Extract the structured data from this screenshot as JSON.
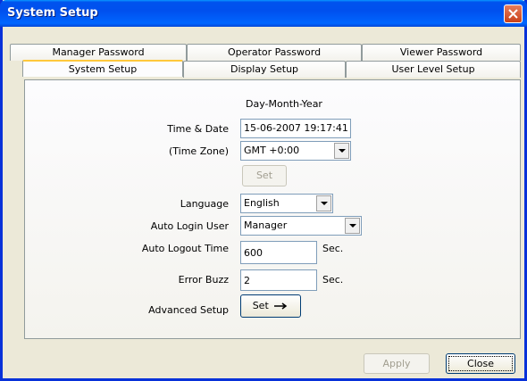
{
  "window": {
    "title": "System Setup"
  },
  "tabs": {
    "row1": [
      "Manager Password",
      "Operator Password",
      "Viewer Password"
    ],
    "row2": [
      "System Setup",
      "Display Setup",
      "User Level Setup"
    ]
  },
  "form": {
    "date_format": "Day-Month-Year",
    "time_date_label": "Time & Date",
    "time_date_value": "15-06-2007 19:17:41",
    "timezone_label": "(Time Zone)",
    "timezone_value": "GMT +0:00",
    "set_label": "Set",
    "language_label": "Language",
    "language_value": "English",
    "auto_login_label": "Auto Login User",
    "auto_login_value": "Manager",
    "auto_logout_label": "Auto Logout Time",
    "auto_logout_value": "600",
    "auto_logout_unit": "Sec.",
    "error_buzz_label": "Error Buzz",
    "error_buzz_value": "2",
    "error_buzz_unit": "Sec.",
    "advanced_label": "Advanced Setup",
    "advanced_button": "Set"
  },
  "footer": {
    "apply": "Apply",
    "close": "Close"
  },
  "icons": {
    "close": "close-icon",
    "dropdown": "chevron-down-icon",
    "arrow": "arrow-right-icon"
  }
}
